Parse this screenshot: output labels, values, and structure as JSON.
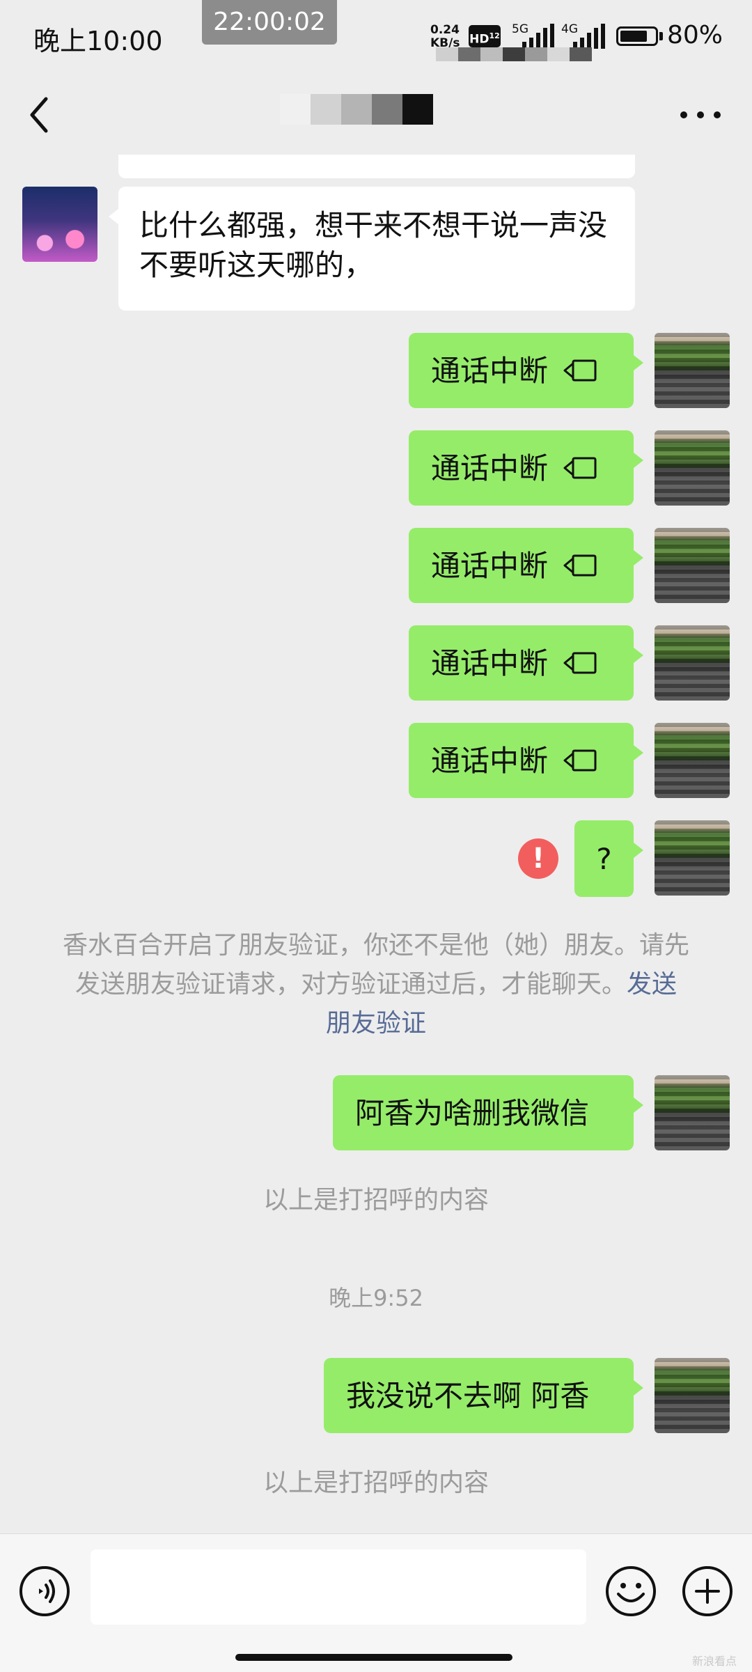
{
  "status_bar": {
    "time": "晚上10:00",
    "recording_timer": "22:00:02",
    "net_speed_value": "0.24",
    "net_speed_unit": "KB/s",
    "hd_label": "HD",
    "hd_sub": "12",
    "sig1_label": "5G",
    "sig2_label": "4G",
    "battery_level": 0.8,
    "battery_text": "80%"
  },
  "nav": {
    "back_icon": "chevron-left-icon",
    "title_mosaic_colors": [
      "#f0f0f0",
      "#d2d2d2",
      "#b4b4b4",
      "#7a7a7a",
      "#111111"
    ],
    "more_icon": "more-dots-icon"
  },
  "messages": {
    "m1": "比什么都强，想干来不想干说一声没不要听这天哪的，",
    "call_label": "通话中断",
    "call_icon": "video-call-icon",
    "question": "?",
    "error_icon": "exclamation-icon",
    "error_mark": "!",
    "sys_friend_text": "香水百合开启了朋友验证，你还不是他（她）朋友。请先发送朋友验证请求，对方验证通过后，才能聊天。",
    "sys_friend_link": "发送朋友验证",
    "m_delete": "阿香为啥删我微信",
    "greet_note_1": "以上是打招呼的内容",
    "time_divider": "晚上9:52",
    "m_last": "我没说不去啊 阿香",
    "greet_note_2": "以上是打招呼的内容"
  },
  "input_bar": {
    "voice_icon": "voice-icon",
    "text_value": "",
    "emoji_icon": "emoji-icon",
    "plus_icon": "plus-icon"
  },
  "watermark": "新浪看点"
}
